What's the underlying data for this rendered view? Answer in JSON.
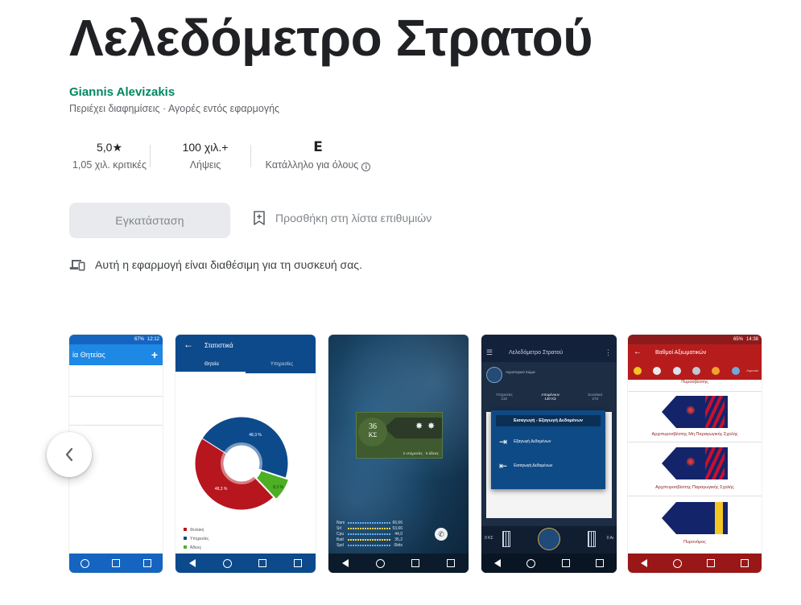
{
  "app": {
    "title": "Λελεδόμετρο Στρατού",
    "developer": "Giannis Alevizakis",
    "subtitle": "Περιέχει διαφημίσεις · Αγορές εντός εφαρμογής"
  },
  "stats": {
    "rating_value": "5,0★",
    "rating_label": "1,05 χιλ. κριτικές",
    "downloads_value": "100 χιλ.+",
    "downloads_label": "Λήψεις",
    "content_rating_symbol": "E",
    "content_rating_label": "Κατάλληλο για όλους"
  },
  "actions": {
    "install_label": "Εγκατάσταση",
    "wishlist_label": "Προσθήκη στη λίστα επιθυμιών"
  },
  "devices_note": "Αυτή η εφαρμογή είναι διαθέσιμη για τη συσκευή σας.",
  "screenshots": {
    "s1": {
      "status_time": "12:12",
      "status_battery": "67%",
      "title": "ία Θητείας",
      "add_icon": "+"
    },
    "s2": {
      "header": "Στατιστικά",
      "tab1": "Θητεία",
      "tab2": "Υπηρεσίες",
      "chart_data": {
        "type": "pie",
        "categories": [
          "Υπηρεσίες",
          "Φυλακή",
          "Άδειες"
        ],
        "values": [
          48.3,
          48.3,
          8.3
        ],
        "labels": [
          "48,3 %",
          "48,3 %",
          "8,3 %"
        ],
        "colors": [
          "#0d4a8c",
          "#b7161f",
          "#4caf24"
        ]
      },
      "legend": [
        "Φυλακή",
        "Υπηρεσίες",
        "Άδειες"
      ]
    },
    "s3": {
      "days_num": "36",
      "days_unit": "ΚΣ",
      "card_text": "2 υπηρεσίες · 5 άδειες",
      "bars": [
        {
          "label": "Nsm",
          "value": "66,66"
        },
        {
          "label": "Srl",
          "value": "53,66"
        },
        {
          "label": "Cpu",
          "value": "44,0"
        },
        {
          "label": "Batt",
          "value": "35,2"
        },
        {
          "label": "Spd",
          "value": "0bits"
        }
      ]
    },
    "s4": {
      "header": "Λελεδόμετρο Στρατού",
      "unit": "Αεροπορικό Σώμα",
      "col1_label": "Υπηρεσίες",
      "col1_value": "132",
      "col2_label": "Απομένουν",
      "col2_value": "140 ΚΣ",
      "col3_label": "Συνολικό",
      "col3_value": "273",
      "dialog_title": "Εισαγωγή - Εξαγωγή Δεδομένων",
      "dialog_item1": "Εξαγωγή Δεδομένων",
      "dialog_item2": "Εισαγωγή Δεδομένων",
      "bottom_left": "0 ΚΣ",
      "bottom_right": "0 Αι"
    },
    "s5": {
      "status_time": "14:38",
      "status_battery": "65%",
      "header": "Βαθμοί Αξιωματικών",
      "top_partial": "Πυροσβέστης",
      "rank1": "Αρχιπυροσβέστης Μη Παραγωγικής Σχολής",
      "rank2": "Αρχιπυροσβέστης Παραγωγικής Σχολής",
      "rank3": "Πυρονόμος",
      "tab_partial": "Λιμενικό"
    }
  },
  "colors": {
    "developer_green": "#01875f",
    "install_bg": "#e8eaed",
    "muted_text": "#5f6368"
  }
}
